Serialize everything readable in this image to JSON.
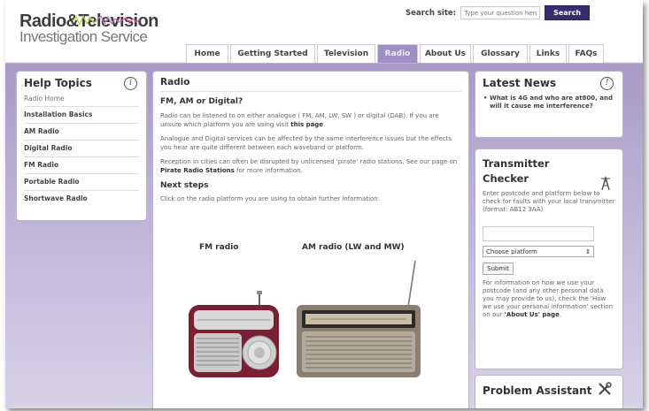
{
  "header": {
    "logo_title": "Radio&Television",
    "logo_subtitle": "Investigation Service"
  },
  "search": {
    "label": "Search site:",
    "placeholder": "Type your question here",
    "button": "Search"
  },
  "nav": {
    "tabs": [
      {
        "label": "Home",
        "active": false
      },
      {
        "label": "Getting Started",
        "active": false
      },
      {
        "label": "Television",
        "active": false
      },
      {
        "label": "Radio",
        "active": true
      },
      {
        "label": "About Us",
        "active": false
      },
      {
        "label": "Glossary",
        "active": false
      },
      {
        "label": "Links",
        "active": false
      },
      {
        "label": "FAQs",
        "active": false
      }
    ]
  },
  "help": {
    "title": "Help Topics",
    "items": [
      "Radio Home",
      "Installation Basics",
      "AM Radio",
      "Digital Radio",
      "FM Radio",
      "Portable Radio",
      "Shortwave Radio"
    ]
  },
  "main": {
    "title": "Radio",
    "heading": "FM, AM or Digital?",
    "p1_text": "Radio can be listened to on either analogue ( FM, AM, LW, SW ) or digital (DAB). If you are unsure which platform you are using visit",
    "p1_link": "this page",
    "p1_end": ".",
    "p2": "Analogue and Digital services can be affected by the same interference issues but the effects you hear are quite different between each waveband or platform.",
    "p3_text": "Reception in cities can often be disrupted by unlicensed 'pirate' radio stations. See our page on",
    "p3_link": "Pirate Radio Stations",
    "p3_end": "for more information.",
    "next_steps_title": "Next steps",
    "next_steps_text": "Click on the radio platform you are using to obtain further information:",
    "fm_caption": "FM radio",
    "am_caption": "AM radio (LW and MW)"
  },
  "news": {
    "title": "Latest News",
    "item": "What is 4G and who are at800, and will it cause me interference?"
  },
  "transmitter": {
    "title_line1": "Transmitter",
    "title_line2": "Checker",
    "desc": "Enter postcode and platform below to check for faults with your local transmitter (format: AB12 3AA)",
    "select": "Choose platform",
    "submit": "Submit",
    "info_text": "For information on how we use your postcode (and any other personal data you may provide to us), check the 'How we use your personal information' section on our",
    "info_link": "'About Us' page",
    "info_end": "."
  },
  "problem": {
    "title": "Problem Assistant"
  }
}
